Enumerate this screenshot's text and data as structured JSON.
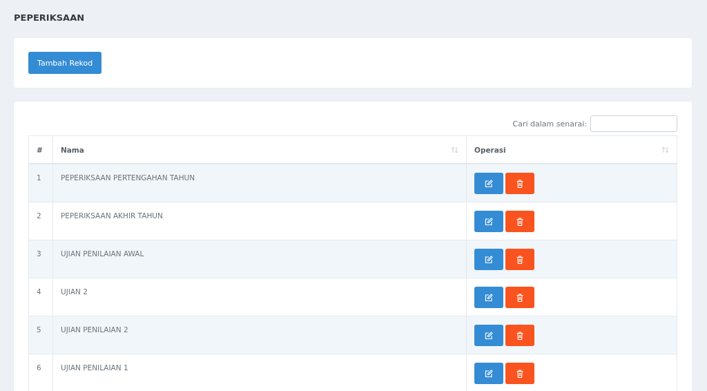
{
  "page_title": "PEPERIKSAAN",
  "add_button": "Tambah Rekod",
  "search": {
    "label": "Cari dalam senarai:"
  },
  "table": {
    "columns": [
      {
        "label": "#",
        "sortable": false
      },
      {
        "label": "Nama",
        "sortable": true
      },
      {
        "label": "Operasi",
        "sortable": true
      }
    ],
    "rows": [
      {
        "no": "1",
        "name": "PEPERIKSAAN PERTENGAHAN TAHUN"
      },
      {
        "no": "2",
        "name": "PEPERIKSAAN AKHIR TAHUN"
      },
      {
        "no": "3",
        "name": "UJIAN PENILAIAN AWAL"
      },
      {
        "no": "4",
        "name": "UJIAN 2"
      },
      {
        "no": "5",
        "name": "UJIAN PENILAIAN 2"
      },
      {
        "no": "6",
        "name": "UJIAN PENILAIAN 1"
      }
    ]
  }
}
